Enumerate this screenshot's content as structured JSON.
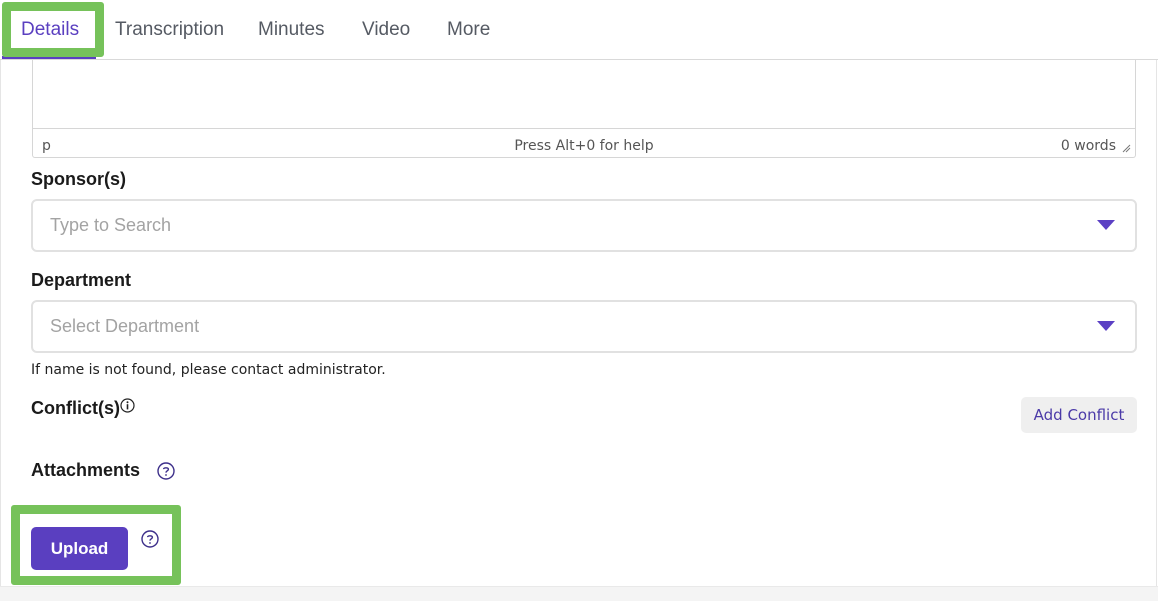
{
  "tabs": [
    {
      "label": "Details",
      "active": true
    },
    {
      "label": "Transcription"
    },
    {
      "label": "Minutes"
    },
    {
      "label": "Video"
    },
    {
      "label": "More"
    }
  ],
  "editor": {
    "path": "p",
    "help": "Press Alt+0 for help",
    "word_count": "0 words"
  },
  "sponsors": {
    "label": "Sponsor(s)",
    "placeholder": "Type to Search"
  },
  "department": {
    "label": "Department",
    "placeholder": "Select Department",
    "hint": "If name is not found, please contact administrator."
  },
  "conflicts": {
    "label": "Conflict(s)",
    "add_button": "Add Conflict"
  },
  "attachments": {
    "label": "Attachments",
    "upload_button": "Upload"
  },
  "colors": {
    "accent": "#5a3fc0",
    "highlight": "#76c25a"
  }
}
